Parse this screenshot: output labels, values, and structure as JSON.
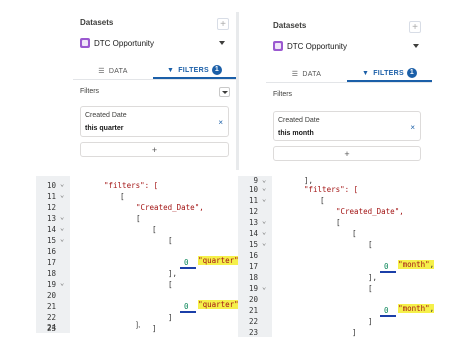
{
  "left_panel": {
    "datasets_label": "Datasets",
    "add_symbol": "+",
    "dataset_name": "DTC Opportunity",
    "tabs": [
      {
        "label": "DATA",
        "icon": "list-icon"
      },
      {
        "label": "FILTERS",
        "icon": "filter-icon",
        "badge": "1"
      }
    ],
    "filters_label": "Filters",
    "filter": {
      "field": "Created Date",
      "value": "this quarter",
      "close": "×"
    },
    "add_filter_symbol": "+"
  },
  "right_panel": {
    "datasets_label": "Datasets",
    "add_symbol": "+",
    "dataset_name": "DTC Opportunity",
    "tabs": [
      {
        "label": "DATA",
        "icon": "list-icon"
      },
      {
        "label": "FILTERS",
        "icon": "filter-icon",
        "badge": "1"
      }
    ],
    "filters_label": "Filters",
    "filter": {
      "field": "Created Date",
      "value": "this month",
      "close": "×"
    },
    "add_filter_symbol": "+"
  },
  "left_code": {
    "line_numbers": [
      "10",
      "11",
      "12",
      "13",
      "14",
      "15",
      "16",
      "17",
      "18",
      "19",
      "20",
      "21",
      "22",
      "23",
      "24"
    ],
    "lines": {
      "l10": "\"filters\": [",
      "l11": "[",
      "l12": "\"Created_Date\",",
      "l13": "[",
      "l14": "[",
      "l15": "[",
      "l16_str": "\"quarter\"",
      "l16_comma": ",",
      "l17": "0",
      "l18": "],",
      "l19": "[",
      "l20_str": "\"quarter\"",
      "l20_comma": ",",
      "l21": "0",
      "l22": "]",
      "l23": "]",
      "l24": "],"
    }
  },
  "right_code": {
    "line_numbers": [
      "9",
      "10",
      "11",
      "12",
      "13",
      "14",
      "15",
      "16",
      "17",
      "18",
      "19",
      "20",
      "21",
      "22",
      "23",
      "24"
    ],
    "lines": {
      "l9": "],",
      "l10": "\"filters\": [",
      "l11": "[",
      "l12": "\"Created_Date\",",
      "l13": "[",
      "l14": "[",
      "l16_str": "\"month\"",
      "l16_comma": ",",
      "l17": "0",
      "l18": "],",
      "l19": "[",
      "l20_str": "\"month\"",
      "l20_comma": ",",
      "l21": "0",
      "l22": "]",
      "l23": "]",
      "l24": "],"
    }
  },
  "colors": {
    "accent": "#1b5fa8",
    "dataset_icon": "#9b59d0",
    "highlight": "#f5f04a",
    "underline": "#1b3fa8"
  }
}
